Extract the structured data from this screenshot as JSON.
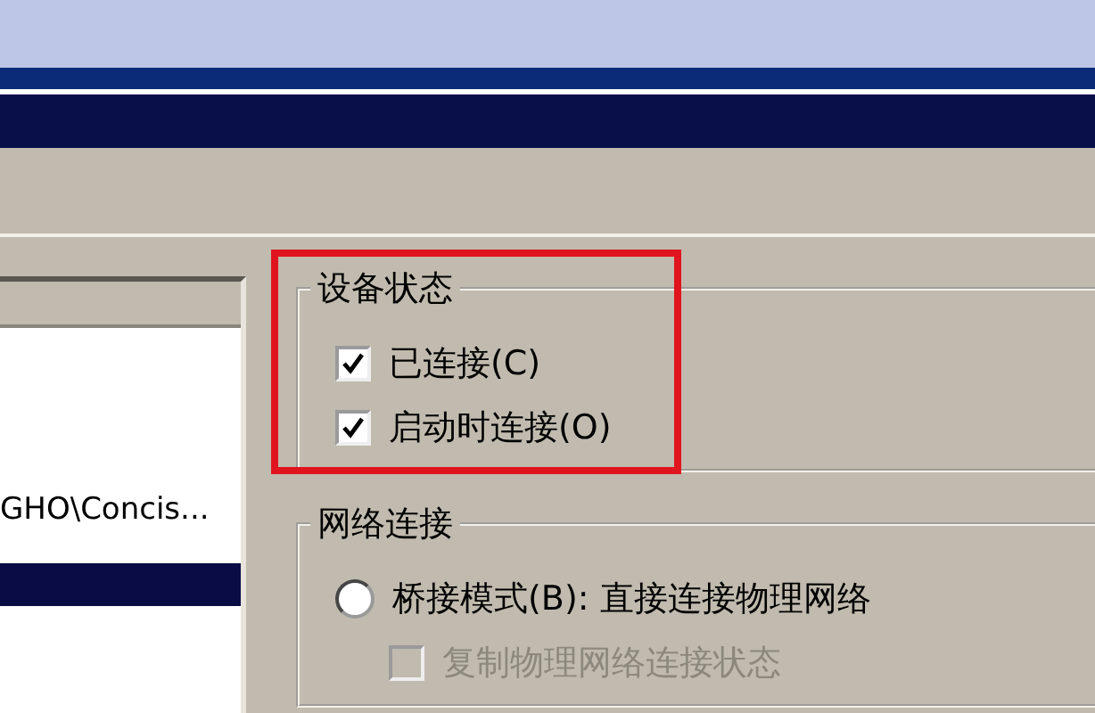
{
  "device_list": {
    "rows": [
      {
        "text": "GHO\\Concis...",
        "selected": false
      },
      {
        "text": "",
        "selected": true
      }
    ]
  },
  "device_status": {
    "title": "设备状态",
    "options": [
      {
        "label": "已连接(C)",
        "checked": true
      },
      {
        "label": "启动时连接(O)",
        "checked": true
      }
    ]
  },
  "network_connection": {
    "title": "网络连接",
    "options": [
      {
        "kind": "radio",
        "label": "桥接模式(B): 直接连接物理网络",
        "selected": false,
        "disabled": false
      },
      {
        "kind": "checkbox",
        "label": "复制物理网络连接状态",
        "checked": false,
        "disabled": true
      }
    ]
  }
}
